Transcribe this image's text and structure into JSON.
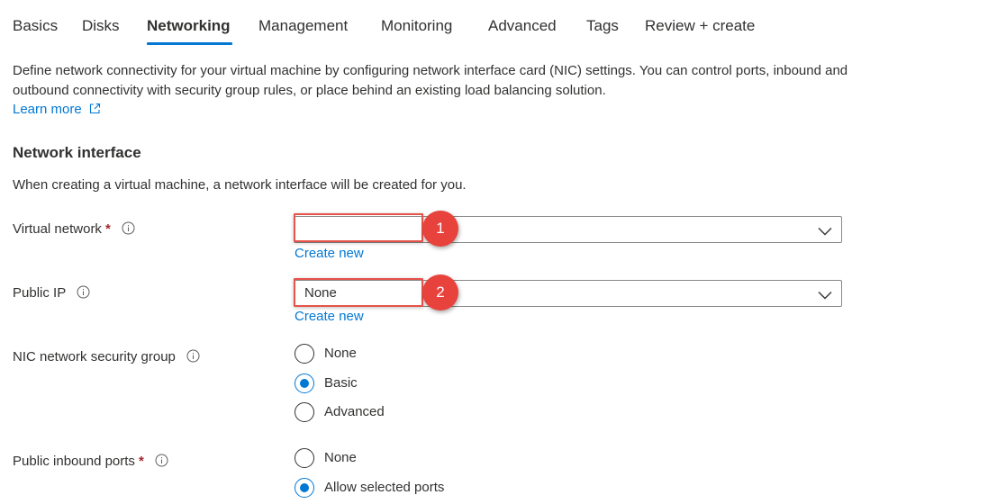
{
  "tabs": [
    {
      "label": "Basics"
    },
    {
      "label": "Disks"
    },
    {
      "label": "Networking"
    },
    {
      "label": "Management"
    },
    {
      "label": "Monitoring"
    },
    {
      "label": "Advanced"
    },
    {
      "label": "Tags"
    },
    {
      "label": "Review + create"
    }
  ],
  "active_tab": "Networking",
  "description": "Define network connectivity for your virtual machine by configuring network interface card (NIC) settings. You can control ports, inbound and outbound connectivity with security group rules, or place behind an existing load balancing solution.",
  "learn_more": "Learn more",
  "network_interface": {
    "title": "Network interface",
    "subtitle": "When creating a virtual machine, a network interface will be created for you."
  },
  "fields": {
    "virtual_network": {
      "label": "Virtual network",
      "required_mark": "*",
      "value": "",
      "create_new": "Create new",
      "callout": "1"
    },
    "public_ip": {
      "label": "Public IP",
      "value": "None",
      "create_new": "Create new",
      "callout": "2"
    },
    "nic_nsg": {
      "label": "NIC network security group",
      "options": [
        "None",
        "Basic",
        "Advanced"
      ],
      "selected": "Basic"
    },
    "public_inbound_ports": {
      "label": "Public inbound ports",
      "required_mark": "*",
      "options": [
        "None",
        "Allow selected ports"
      ],
      "selected": "Allow selected ports"
    }
  },
  "colors": {
    "accent": "#0078d4",
    "required": "#a4262c",
    "callout": "#e8423c",
    "text": "#323130"
  }
}
